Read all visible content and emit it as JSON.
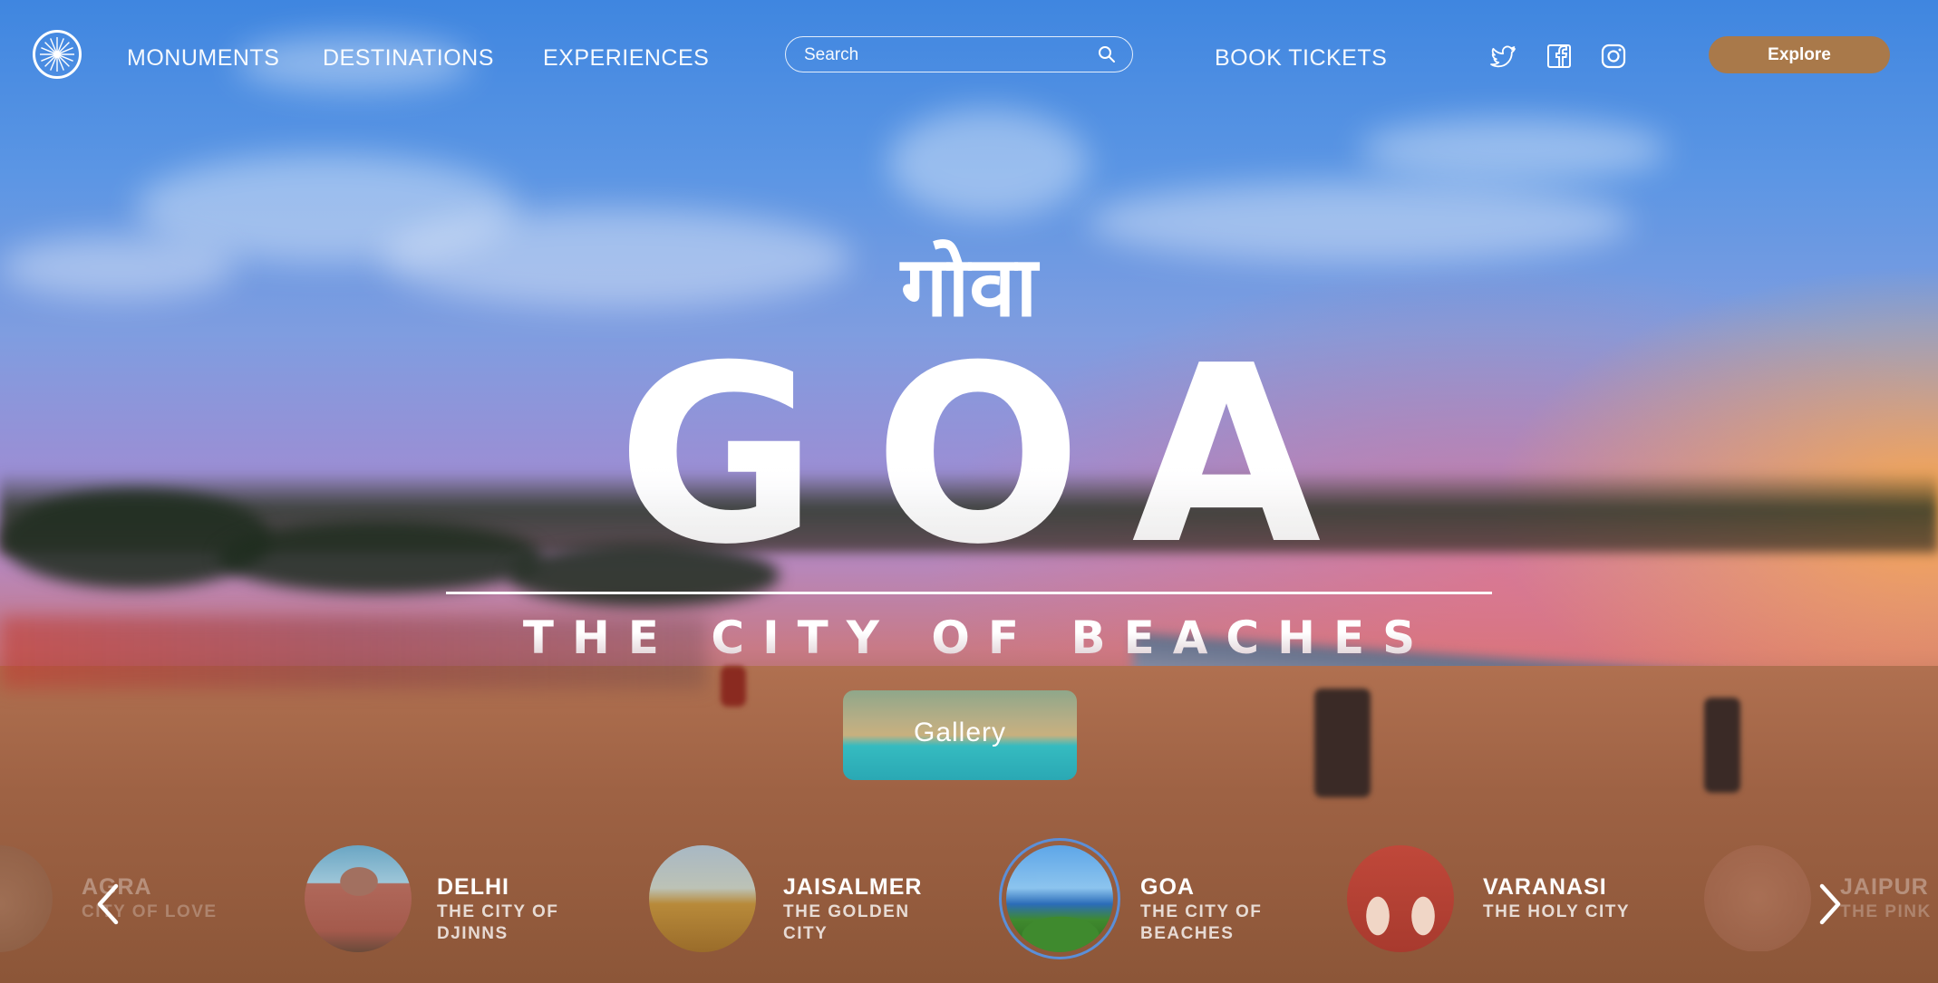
{
  "header": {
    "nav": [
      {
        "label": "MONUMENTS"
      },
      {
        "label": "DESTINATIONS"
      },
      {
        "label": "EXPERIENCES"
      }
    ],
    "search_placeholder": "Search",
    "book_label": "BOOK TICKETS",
    "social_icons": [
      "twitter-icon",
      "facebook-icon",
      "instagram-icon"
    ],
    "explore_label": "Explore"
  },
  "hero": {
    "native_title": "गोवा",
    "title": "GOA",
    "subtitle": "THE CITY OF BEACHES",
    "gallery_label": "Gallery"
  },
  "carousel": {
    "cities": [
      {
        "name": "AGRA",
        "tag": "CITY OF LOVE"
      },
      {
        "name": "DELHI",
        "tag": "THE CITY OF DJINNS"
      },
      {
        "name": "JAISALMER",
        "tag": "THE GOLDEN CITY"
      },
      {
        "name": "GOA",
        "tag": "THE CITY OF BEACHES"
      },
      {
        "name": "VARANASI",
        "tag": "THE HOLY CITY"
      },
      {
        "name": "JAIPUR",
        "tag": "THE PINK"
      }
    ],
    "active": "GOA"
  },
  "colors": {
    "accent": "#a9794a",
    "active_ring": "#5b8fd8"
  }
}
